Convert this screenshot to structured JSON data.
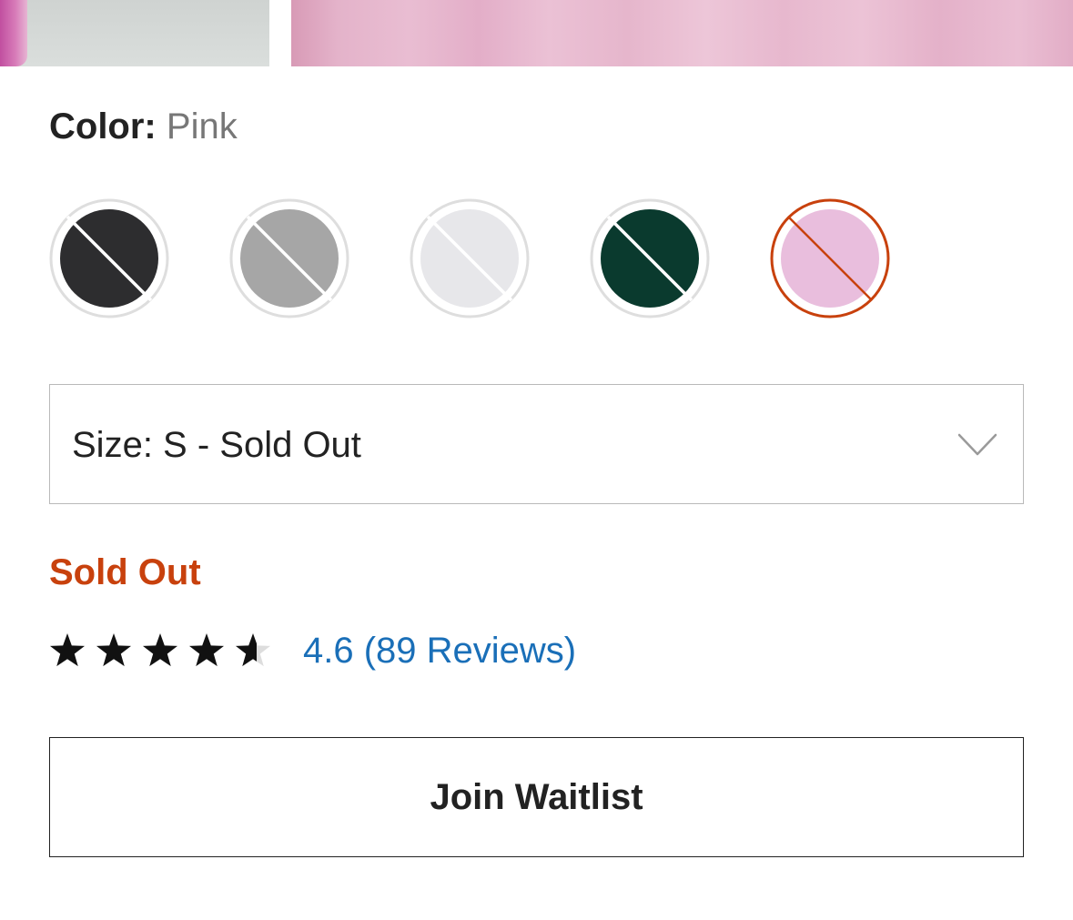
{
  "color": {
    "label": "Color:",
    "selected": "Pink",
    "swatches": [
      {
        "name": "swatch-charcoal",
        "fill": "#2d2d2f",
        "selected": false,
        "available": false
      },
      {
        "name": "swatch-heather-grey",
        "fill": "#a6a6a6",
        "selected": false,
        "available": false
      },
      {
        "name": "swatch-light-grey",
        "fill": "#e7e7ea",
        "selected": false,
        "available": false
      },
      {
        "name": "swatch-forest-green",
        "fill": "#0a3a2e",
        "selected": false,
        "available": false
      },
      {
        "name": "swatch-pink",
        "fill": "#e9bedd",
        "selected": true,
        "available": false
      }
    ]
  },
  "size": {
    "label": "Size: S - Sold Out"
  },
  "status": {
    "text": "Sold Out"
  },
  "rating": {
    "value": 4.6,
    "max": 5,
    "reviews_text": "4.6 (89 Reviews)"
  },
  "waitlist": {
    "label": "Join Waitlist"
  },
  "theme": {
    "accent": "#c8410d",
    "link": "#1a6fb8",
    "text": "#222222",
    "muted": "#777777",
    "swatch_ring": "#dedede",
    "strike": "#ffffff",
    "star_filled": "#111111",
    "star_empty": "#dddddd"
  }
}
